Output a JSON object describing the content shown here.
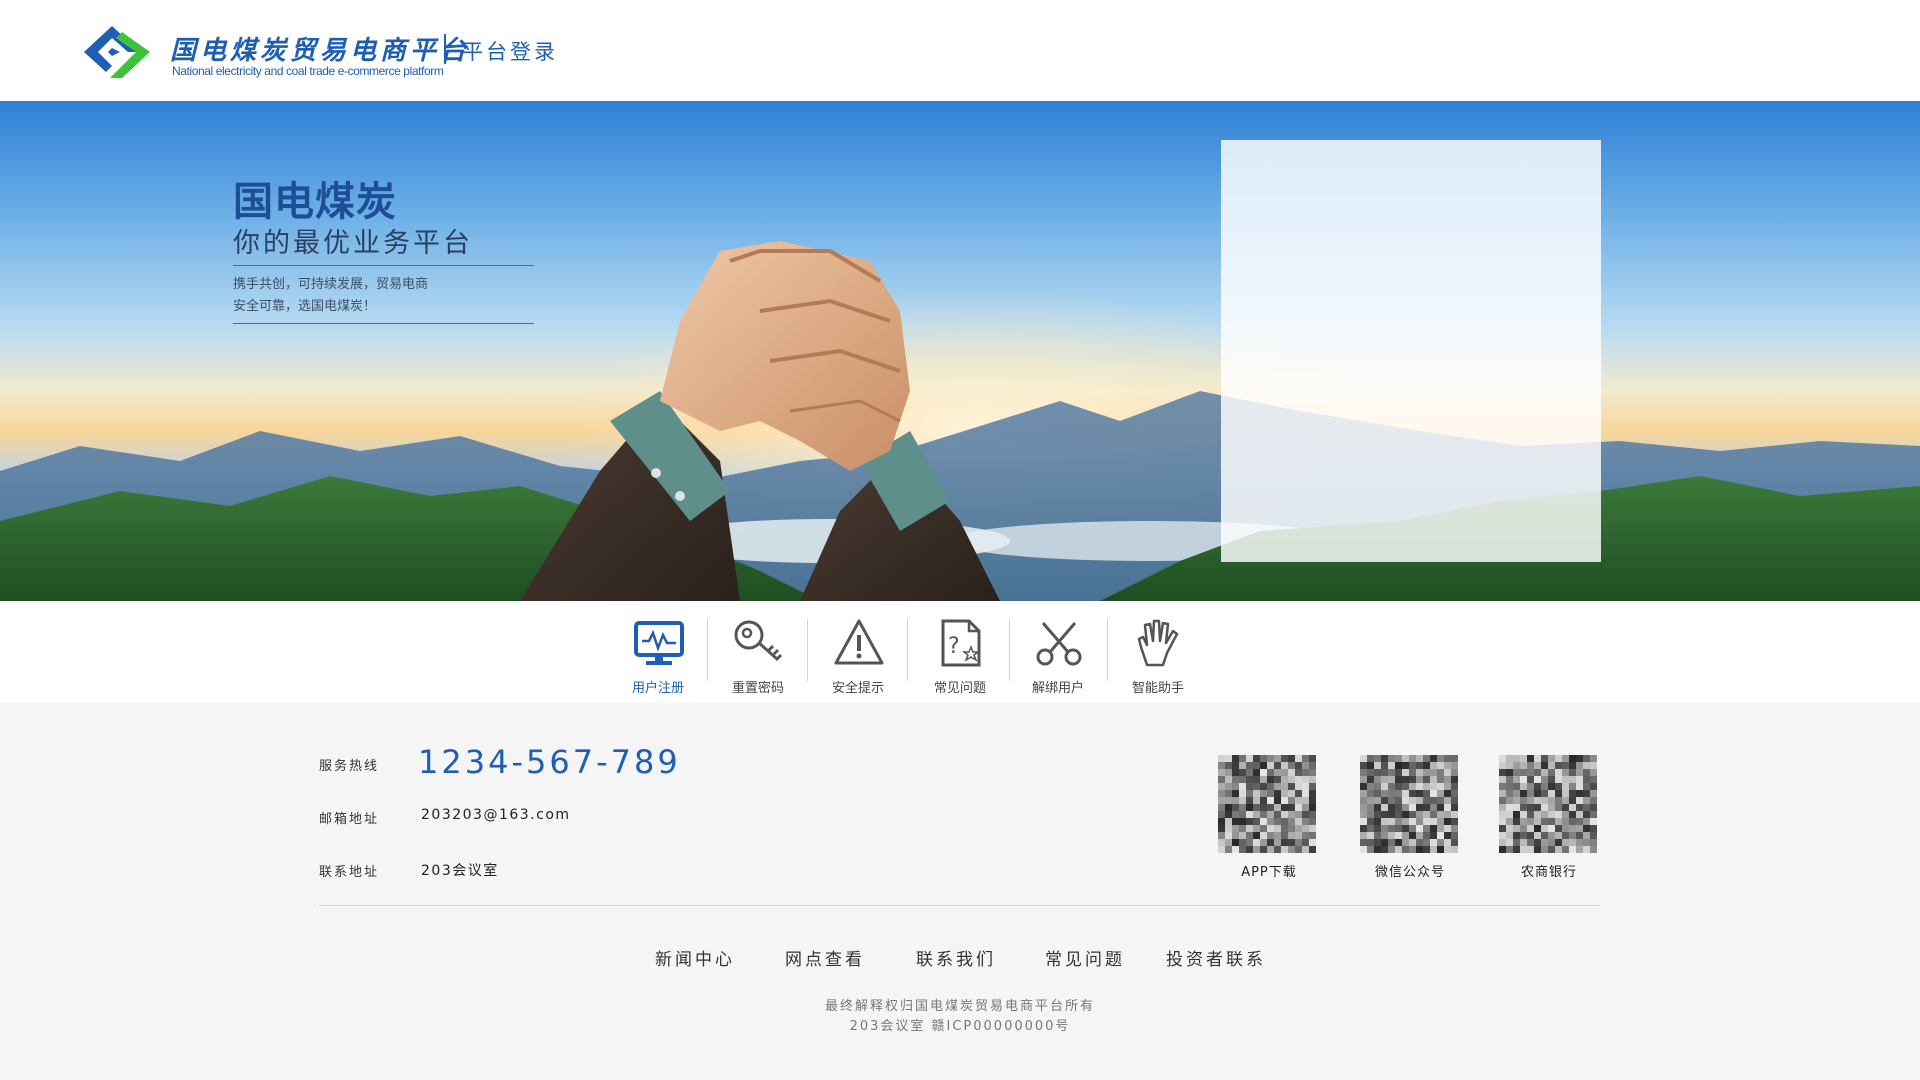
{
  "header": {
    "logo_cn": "国电煤炭贸易电商平台",
    "logo_en": "National electricity and coal trade e-commerce platform",
    "login_title": "平台登录",
    "logo_colors": {
      "blue": "#1e5eb4",
      "green": "#3ec23a"
    }
  },
  "banner": {
    "title": "国电煤炭",
    "subtitle": "你的最优业务平台",
    "desc_line1": "携手共创，可持续发展，贸易电商",
    "desc_line2": "安全可靠，选国电煤炭！"
  },
  "iconbar": {
    "items": [
      {
        "label": "用户注册",
        "icon": "monitor-icon",
        "active": true
      },
      {
        "label": "重置密码",
        "icon": "key-icon",
        "active": false
      },
      {
        "label": "安全提示",
        "icon": "warning-icon",
        "active": false
      },
      {
        "label": "常见问题",
        "icon": "question-document-icon",
        "active": false
      },
      {
        "label": "解绑用户",
        "icon": "scissors-icon",
        "active": false
      },
      {
        "label": "智能助手",
        "icon": "hand-icon",
        "active": false
      }
    ],
    "active_color": "#1e5eb4",
    "icon_color": "#555555"
  },
  "footer": {
    "hotline_label": "服务热线",
    "hotline_value": "1234-567-789",
    "email_label": "邮箱地址",
    "email_value": "203203@163.com",
    "address_label": "联系地址",
    "address_value": "203会议室",
    "qrcodes": [
      {
        "label": "APP下载"
      },
      {
        "label": "微信公众号"
      },
      {
        "label": "农商银行"
      }
    ],
    "nav": [
      "新闻中心",
      "网点查看",
      "联系我们",
      "常见问题",
      "投资者联系"
    ],
    "copyright_line1": "最终解释权归国电煤炭贸易电商平台所有",
    "copyright_line2": "203会议室 赣ICP00000000号"
  }
}
